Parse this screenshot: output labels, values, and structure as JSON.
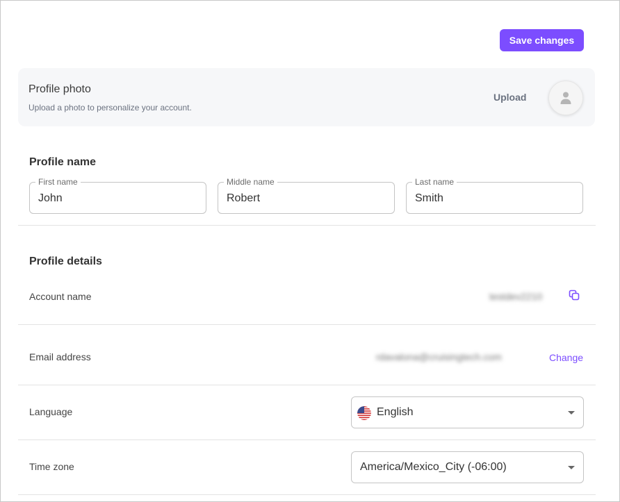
{
  "toolbar": {
    "save_label": "Save changes"
  },
  "profile_photo": {
    "title": "Profile photo",
    "subtitle": "Upload a photo to personalize your account.",
    "upload_label": "Upload",
    "avatar_icon": "user-icon"
  },
  "profile_name": {
    "title": "Profile name",
    "fields": [
      {
        "label": "First name",
        "value": "John"
      },
      {
        "label": "Middle name",
        "value": "Robert"
      },
      {
        "label": "Last name",
        "value": "Smith"
      }
    ]
  },
  "profile_details": {
    "title": "Profile details",
    "account_name": {
      "label": "Account name",
      "value": "testdev2210",
      "copy_icon": "copy-icon"
    },
    "email": {
      "label": "Email address",
      "value": "rdavalona@cruisingtech.com",
      "change_label": "Change"
    },
    "language": {
      "label": "Language",
      "value": "English",
      "flag_icon": "us-flag-icon"
    },
    "timezone": {
      "label": "Time zone",
      "value": "America/Mexico_City (-06:00)"
    }
  },
  "colors": {
    "accent": "#7c4dff",
    "card_bg": "#f6f7f9",
    "divider": "#e3e3e3"
  }
}
